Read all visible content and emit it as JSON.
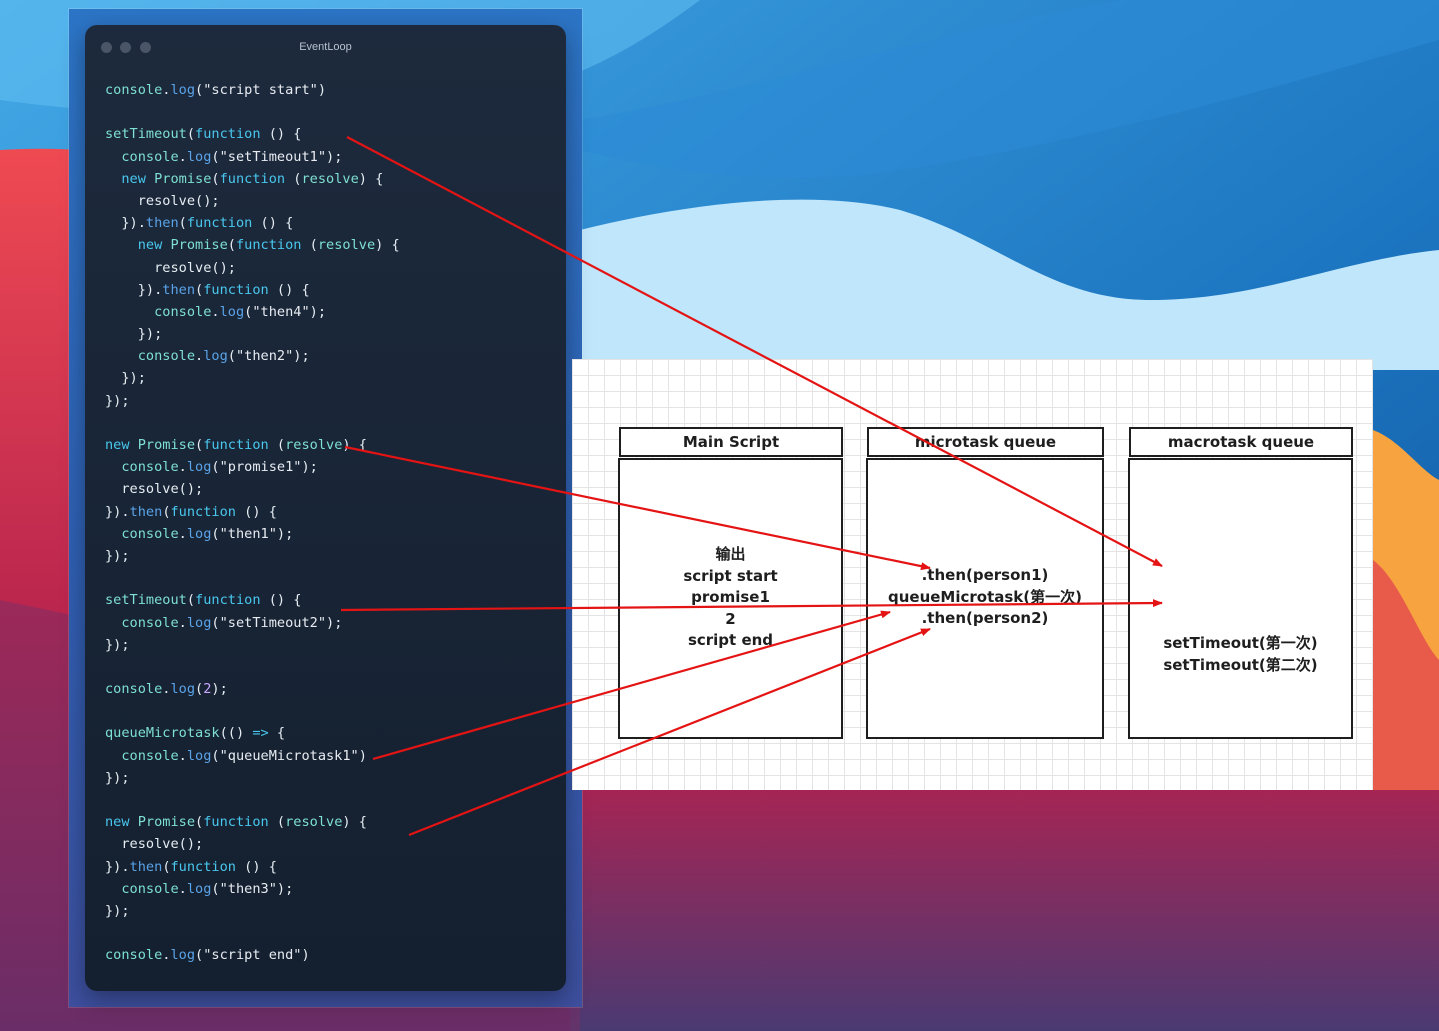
{
  "window": {
    "title": "EventLoop"
  },
  "code_lines": [
    [
      [
        "id",
        "console"
      ],
      [
        "p",
        "."
      ],
      [
        "fn",
        "log"
      ],
      [
        "p",
        "("
      ],
      [
        "s",
        "\"script start\""
      ],
      [
        "p",
        ")"
      ]
    ],
    [],
    [
      [
        "id",
        "setTimeout"
      ],
      [
        "p",
        "("
      ],
      [
        "kw",
        "function"
      ],
      [
        "p",
        " () {"
      ]
    ],
    [
      [
        "p",
        "  "
      ],
      [
        "id",
        "console"
      ],
      [
        "p",
        "."
      ],
      [
        "fn",
        "log"
      ],
      [
        "p",
        "("
      ],
      [
        "s",
        "\"setTimeout1\""
      ],
      [
        "p",
        ");"
      ]
    ],
    [
      [
        "p",
        "  "
      ],
      [
        "kw",
        "new"
      ],
      [
        "p",
        " "
      ],
      [
        "id",
        "Promise"
      ],
      [
        "p",
        "("
      ],
      [
        "kw",
        "function"
      ],
      [
        "p",
        " ("
      ],
      [
        "id",
        "resolve"
      ],
      [
        "p",
        ") {"
      ]
    ],
    [
      [
        "p",
        "    resolve();"
      ]
    ],
    [
      [
        "p",
        "  })."
      ],
      [
        "fn",
        "then"
      ],
      [
        "p",
        "("
      ],
      [
        "kw",
        "function"
      ],
      [
        "p",
        " () {"
      ]
    ],
    [
      [
        "p",
        "    "
      ],
      [
        "kw",
        "new"
      ],
      [
        "p",
        " "
      ],
      [
        "id",
        "Promise"
      ],
      [
        "p",
        "("
      ],
      [
        "kw",
        "function"
      ],
      [
        "p",
        " ("
      ],
      [
        "id",
        "resolve"
      ],
      [
        "p",
        ") {"
      ]
    ],
    [
      [
        "p",
        "      resolve();"
      ]
    ],
    [
      [
        "p",
        "    })."
      ],
      [
        "fn",
        "then"
      ],
      [
        "p",
        "("
      ],
      [
        "kw",
        "function"
      ],
      [
        "p",
        " () {"
      ]
    ],
    [
      [
        "p",
        "      "
      ],
      [
        "id",
        "console"
      ],
      [
        "p",
        "."
      ],
      [
        "fn",
        "log"
      ],
      [
        "p",
        "("
      ],
      [
        "s",
        "\"then4\""
      ],
      [
        "p",
        ");"
      ]
    ],
    [
      [
        "p",
        "    });"
      ]
    ],
    [
      [
        "p",
        "    "
      ],
      [
        "id",
        "console"
      ],
      [
        "p",
        "."
      ],
      [
        "fn",
        "log"
      ],
      [
        "p",
        "("
      ],
      [
        "s",
        "\"then2\""
      ],
      [
        "p",
        ");"
      ]
    ],
    [
      [
        "p",
        "  });"
      ]
    ],
    [
      [
        "p",
        "});"
      ]
    ],
    [],
    [
      [
        "kw",
        "new"
      ],
      [
        "p",
        " "
      ],
      [
        "id",
        "Promise"
      ],
      [
        "p",
        "("
      ],
      [
        "kw",
        "function"
      ],
      [
        "p",
        " ("
      ],
      [
        "id",
        "resolve"
      ],
      [
        "p",
        ") {"
      ]
    ],
    [
      [
        "p",
        "  "
      ],
      [
        "id",
        "console"
      ],
      [
        "p",
        "."
      ],
      [
        "fn",
        "log"
      ],
      [
        "p",
        "("
      ],
      [
        "s",
        "\"promise1\""
      ],
      [
        "p",
        ");"
      ]
    ],
    [
      [
        "p",
        "  resolve();"
      ]
    ],
    [
      [
        "p",
        "})."
      ],
      [
        "fn",
        "then"
      ],
      [
        "p",
        "("
      ],
      [
        "kw",
        "function"
      ],
      [
        "p",
        " () {"
      ]
    ],
    [
      [
        "p",
        "  "
      ],
      [
        "id",
        "console"
      ],
      [
        "p",
        "."
      ],
      [
        "fn",
        "log"
      ],
      [
        "p",
        "("
      ],
      [
        "s",
        "\"then1\""
      ],
      [
        "p",
        ");"
      ]
    ],
    [
      [
        "p",
        "});"
      ]
    ],
    [],
    [
      [
        "id",
        "setTimeout"
      ],
      [
        "p",
        "("
      ],
      [
        "kw",
        "function"
      ],
      [
        "p",
        " () {"
      ]
    ],
    [
      [
        "p",
        "  "
      ],
      [
        "id",
        "console"
      ],
      [
        "p",
        "."
      ],
      [
        "fn",
        "log"
      ],
      [
        "p",
        "("
      ],
      [
        "s",
        "\"setTimeout2\""
      ],
      [
        "p",
        ");"
      ]
    ],
    [
      [
        "p",
        "});"
      ]
    ],
    [],
    [
      [
        "id",
        "console"
      ],
      [
        "p",
        "."
      ],
      [
        "fn",
        "log"
      ],
      [
        "p",
        "("
      ],
      [
        "n",
        "2"
      ],
      [
        "p",
        ");"
      ]
    ],
    [],
    [
      [
        "id",
        "queueMicrotask"
      ],
      [
        "p",
        "(() "
      ],
      [
        "kw",
        "=>"
      ],
      [
        "p",
        " {"
      ]
    ],
    [
      [
        "p",
        "  "
      ],
      [
        "id",
        "console"
      ],
      [
        "p",
        "."
      ],
      [
        "fn",
        "log"
      ],
      [
        "p",
        "("
      ],
      [
        "s",
        "\"queueMicrotask1\""
      ],
      [
        "p",
        ")"
      ]
    ],
    [
      [
        "p",
        "});"
      ]
    ],
    [],
    [
      [
        "kw",
        "new"
      ],
      [
        "p",
        " "
      ],
      [
        "id",
        "Promise"
      ],
      [
        "p",
        "("
      ],
      [
        "kw",
        "function"
      ],
      [
        "p",
        " ("
      ],
      [
        "id",
        "resolve"
      ],
      [
        "p",
        ") {"
      ]
    ],
    [
      [
        "p",
        "  resolve();"
      ]
    ],
    [
      [
        "p",
        "})."
      ],
      [
        "fn",
        "then"
      ],
      [
        "p",
        "("
      ],
      [
        "kw",
        "function"
      ],
      [
        "p",
        " () {"
      ]
    ],
    [
      [
        "p",
        "  "
      ],
      [
        "id",
        "console"
      ],
      [
        "p",
        "."
      ],
      [
        "fn",
        "log"
      ],
      [
        "p",
        "("
      ],
      [
        "s",
        "\"then3\""
      ],
      [
        "p",
        ");"
      ]
    ],
    [
      [
        "p",
        "});"
      ]
    ],
    [],
    [
      [
        "id",
        "console"
      ],
      [
        "p",
        "."
      ],
      [
        "fn",
        "log"
      ],
      [
        "p",
        "("
      ],
      [
        "s",
        "\"script end\""
      ],
      [
        "p",
        ")"
      ]
    ]
  ],
  "diagram": {
    "main_script": {
      "title": "Main Script",
      "lines": [
        "输出",
        "script start",
        "promise1",
        "2",
        "script end"
      ]
    },
    "microtask_queue": {
      "title": "microtask queue",
      "lines": [
        ".then(person1)",
        "queueMicrotask(第一次)",
        ".then(person2)"
      ]
    },
    "macrotask_queue": {
      "title": "macrotask queue",
      "lines": [
        "setTimeout(第一次)",
        "setTimeout(第二次)"
      ]
    }
  },
  "colors": {
    "arrow": "#e41414",
    "code_bg": "#172333",
    "keyword": "#49c7ee",
    "identifier": "#7ee0d4"
  }
}
